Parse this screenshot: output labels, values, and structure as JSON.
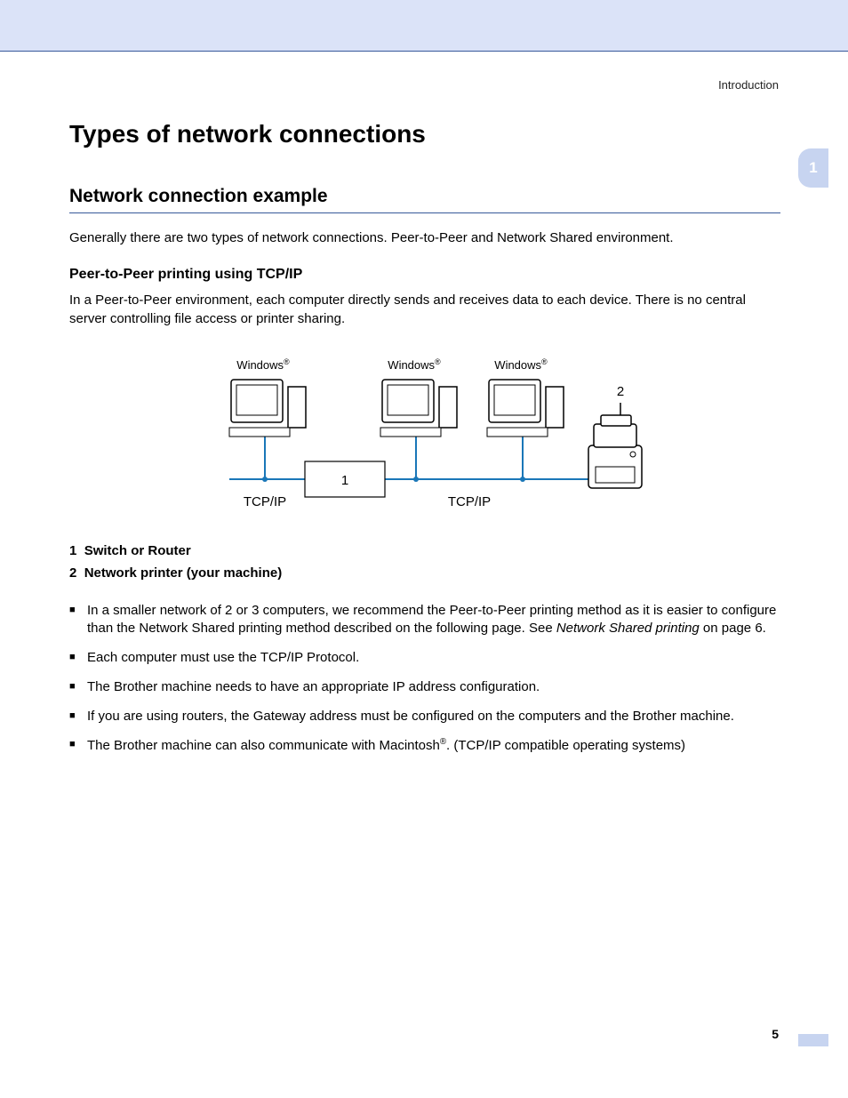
{
  "header": {
    "section": "Introduction",
    "chapter_tab": "1"
  },
  "title": "Types of network connections",
  "subtitle": "Network connection example",
  "intro": "Generally there are two types of network connections. Peer-to-Peer and Network Shared environment.",
  "section_heading": "Peer-to-Peer printing using TCP/IP",
  "section_body": "In a Peer-to-Peer environment, each computer directly sends and receives data to each device. There is no central server controlling file access or printer sharing.",
  "diagram": {
    "computer_label": "Windows",
    "reg": "®",
    "protocol": "TCP/IP",
    "callout_router": "1",
    "callout_printer": "2"
  },
  "legend": {
    "l1_num": "1",
    "l1_text": "Switch or Router",
    "l2_num": "2",
    "l2_text": "Network printer (your machine)"
  },
  "bullets": {
    "b1a": "In a smaller network of 2 or 3 computers, we recommend the Peer-to-Peer printing method as it is easier to configure than the Network Shared printing method described on the following page. See ",
    "b1b": "Network Shared printing",
    "b1c": " on page 6.",
    "b2": "Each computer must use the TCP/IP Protocol.",
    "b3": "The Brother machine needs to have an appropriate IP address configuration.",
    "b4": "If you are using routers, the Gateway address must be configured on the computers and the Brother machine.",
    "b5a": "The Brother machine can also communicate with Macintosh",
    "b5b": ". (TCP/IP compatible operating systems)"
  },
  "footer": {
    "page": "5"
  }
}
